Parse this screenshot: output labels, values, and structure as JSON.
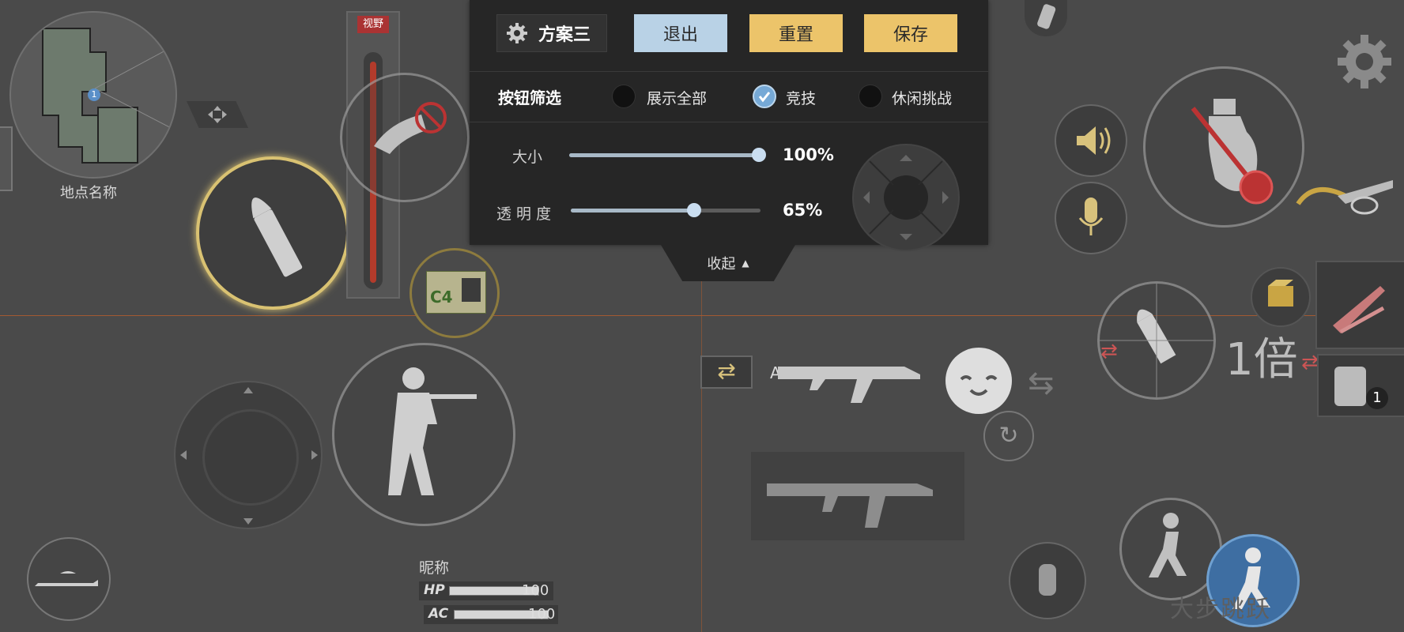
{
  "minimap": {
    "location_label": "地点名称",
    "player_marker": "1"
  },
  "sight_panel": {
    "label": "视野"
  },
  "c4": {
    "label": "C4"
  },
  "settings_panel": {
    "scheme_name": "方案三",
    "exit_label": "退出",
    "reset_label": "重置",
    "save_label": "保存",
    "filter_title": "按钮筛选",
    "filters": [
      {
        "label": "展示全部",
        "checked": false
      },
      {
        "label": "竞技",
        "checked": true
      },
      {
        "label": "休闲挑战",
        "checked": false
      }
    ],
    "size": {
      "label": "大小",
      "value_text": "100%",
      "value": 1.0
    },
    "opacity": {
      "label": "透 明 度",
      "value_text": "65%",
      "value": 0.65
    },
    "collapse_label": "收起"
  },
  "weapon": {
    "primary_name": "AK47"
  },
  "scope": {
    "label": "1倍"
  },
  "backpack": {
    "count": "1"
  },
  "sprint": {
    "label": "大步跳跃"
  },
  "player": {
    "nickname": "昵称",
    "hp_label": "HP",
    "hp_value": "100",
    "hp_fraction": 1.0,
    "ac_label": "AC",
    "ac_value": "100",
    "ac_fraction": 1.0
  },
  "colors": {
    "accent_gold": "#ecc46a",
    "accent_blue": "#b9d2e6",
    "crosshair": "#a35a32"
  }
}
